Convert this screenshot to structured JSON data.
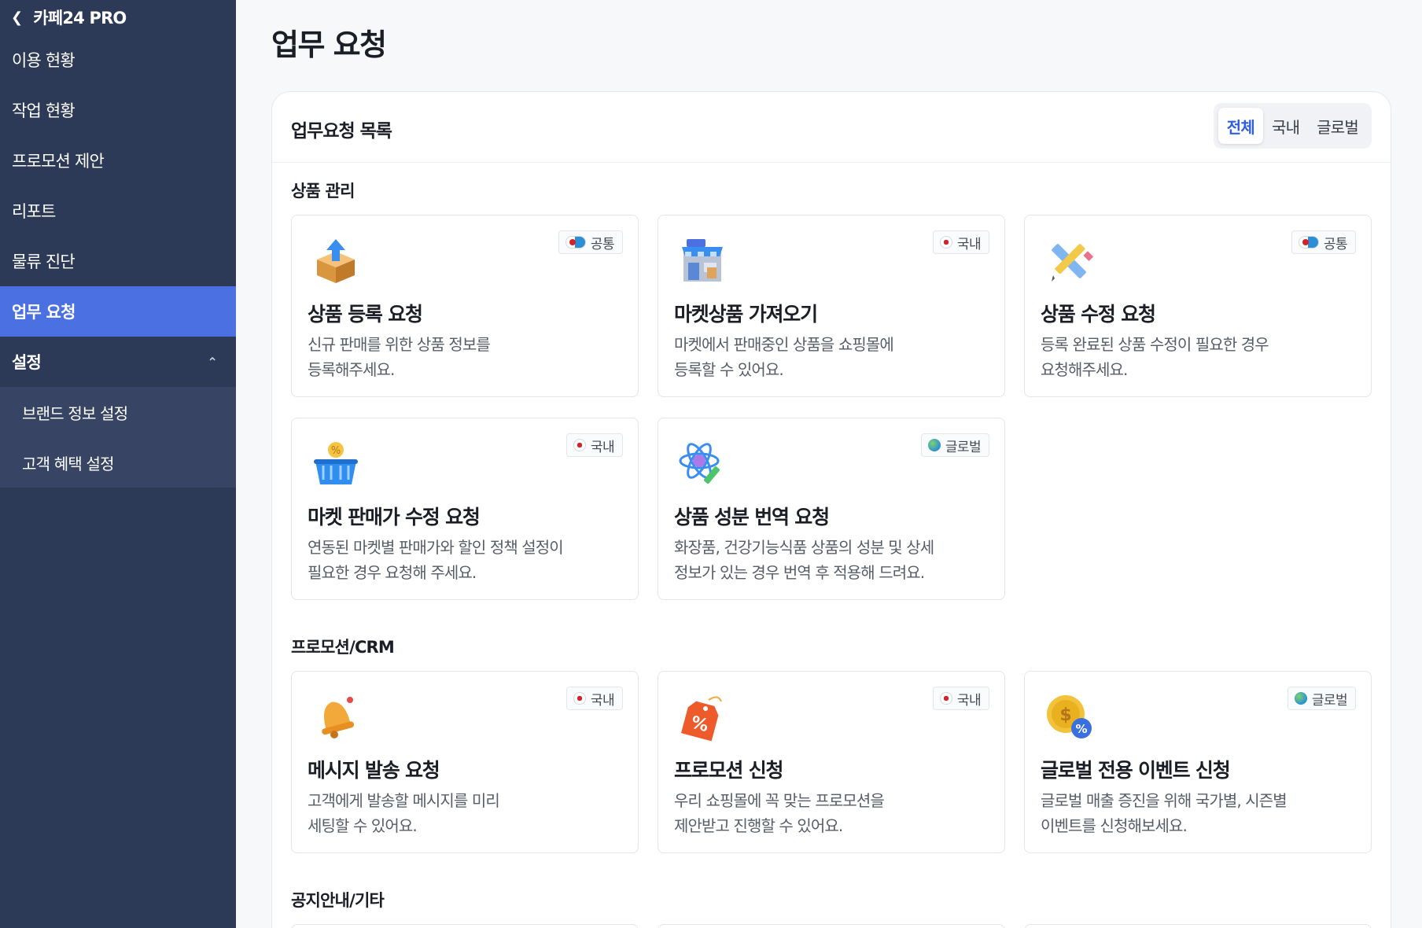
{
  "sidebar": {
    "back_label": "카페24 PRO",
    "items": [
      {
        "label": "이용 현황"
      },
      {
        "label": "작업 현황"
      },
      {
        "label": "프로모션 제안"
      },
      {
        "label": "리포트"
      },
      {
        "label": "물류 진단"
      },
      {
        "label": "업무 요청"
      },
      {
        "label": "설정"
      }
    ],
    "sub_items": [
      {
        "label": "브랜드 정보 설정"
      },
      {
        "label": "고객 혜택 설정"
      }
    ]
  },
  "main": {
    "title": "업무 요청",
    "panel_title": "업무요청 목록",
    "filters": [
      "전체",
      "국내",
      "글로벌"
    ],
    "sections": [
      {
        "title": "상품 관리",
        "cards": [
          {
            "badge": "공통",
            "icon": "box-upload-icon",
            "title": "상품 등록 요청",
            "desc": [
              "신규 판매를 위한 상품 정보를",
              "등록해주세요."
            ]
          },
          {
            "badge": "국내",
            "icon": "store-icon",
            "title": "마켓상품 가져오기",
            "desc": [
              "마켓에서 판매중인 상품을 쇼핑몰에",
              "등록할 수 있어요."
            ]
          },
          {
            "badge": "공통",
            "icon": "pencil-ruler-icon",
            "title": "상품 수정 요청",
            "desc": [
              "등록 완료된 상품 수정이 필요한 경우",
              "요청해주세요."
            ]
          },
          {
            "badge": "국내",
            "icon": "discount-basket-icon",
            "title": "마켓 판매가 수정 요청",
            "desc": [
              "연동된 마켓별 판매가와 할인 정책 설정이",
              "필요한 경우 요청해 주세요."
            ]
          },
          {
            "badge": "글로벌",
            "icon": "atom-pen-icon",
            "title": "상품 성분 번역 요청",
            "desc": [
              "화장품, 건강기능식품 상품의 성분 및 상세",
              "정보가 있는 경우 번역 후 적용해 드려요."
            ]
          }
        ]
      },
      {
        "title": "프로모션/CRM",
        "cards": [
          {
            "badge": "국내",
            "icon": "bell-icon",
            "title": "메시지 발송 요청",
            "desc": [
              "고객에게 발송할 메시지를 미리",
              "세팅할 수 있어요."
            ]
          },
          {
            "badge": "국내",
            "icon": "percent-tag-icon",
            "title": "프로모션 신청",
            "desc": [
              "우리 쇼핑몰에 꼭 맞는 프로모션을",
              "제안받고 진행할 수 있어요."
            ]
          },
          {
            "badge": "글로벌",
            "icon": "coin-percent-icon",
            "title": "글로벌 전용 이벤트 신청",
            "desc": [
              "글로벌 매출 증진을 위해 국가별, 시즌별",
              "이벤트를 신청해보세요."
            ]
          }
        ]
      },
      {
        "title": "공지안내/기타",
        "cards": []
      }
    ]
  }
}
